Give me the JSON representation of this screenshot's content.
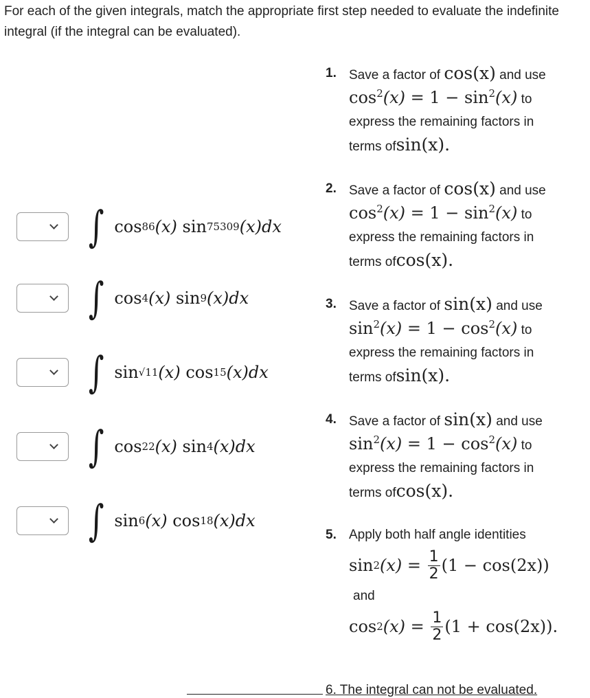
{
  "instructions": "For each of the given integrals, match the appropriate first step needed to evaluate the indefinite integral (if the integral can be evaluated).",
  "integrals": [
    {
      "select_value": "",
      "f1": "cos",
      "e1": "86",
      "f2": "sin",
      "e2": "75309"
    },
    {
      "select_value": "",
      "f1": "cos",
      "e1": "4",
      "f2": "sin",
      "e2": "9"
    },
    {
      "select_value": "",
      "f1": "sin",
      "e1": "√11",
      "f2": "cos",
      "e2": "15"
    },
    {
      "select_value": "",
      "f1": "cos",
      "e1": "22",
      "f2": "sin",
      "e2": "4"
    },
    {
      "select_value": "",
      "f1": "sin",
      "e1": "6",
      "f2": "cos",
      "e2": "18"
    }
  ],
  "common": {
    "arg": "(x)",
    "dx": "dx",
    "integral_sign": "∫"
  },
  "options": [
    {
      "num": "1.",
      "save_text": "Save a factor of",
      "save_fn": "cos(x)",
      "use_text": "and use",
      "identity_lhs": "cos",
      "identity_rhs_fn": "sin",
      "to": "to",
      "express": "express the remaining factors in",
      "terms_of": "terms of",
      "terms_fn": "sin(x)."
    },
    {
      "num": "2.",
      "save_text": "Save a factor of",
      "save_fn": "cos(x)",
      "use_text": "and use",
      "identity_lhs": "cos",
      "identity_rhs_fn": "sin",
      "to": "to",
      "express": "express the remaining factors in",
      "terms_of": "terms of",
      "terms_fn": "cos(x)."
    },
    {
      "num": "3.",
      "save_text": "Save a factor of",
      "save_fn": "sin(x)",
      "use_text": "and use",
      "identity_lhs": "sin",
      "identity_rhs_fn": "cos",
      "to": "to",
      "express": "express the remaining factors in",
      "terms_of": "terms of",
      "terms_fn": "sin(x)."
    },
    {
      "num": "4.",
      "save_text": "Save a factor of",
      "save_fn": "sin(x)",
      "use_text": "and use",
      "identity_lhs": "sin",
      "identity_rhs_fn": "cos",
      "to": "to",
      "express": "express the remaining factors in",
      "terms_of": "terms of",
      "terms_fn": "cos(x)."
    }
  ],
  "option5": {
    "num": "5.",
    "text": "Apply both half angle identities",
    "eq1_lhs": "sin",
    "eq1_rhs": "(1 − cos(2x))",
    "and": "and",
    "eq2_lhs": "cos",
    "eq2_rhs": "(1 + cos(2x)).",
    "frac_num": "1",
    "frac_den": "2"
  },
  "option6": "6.  The integral can not be evaluated."
}
